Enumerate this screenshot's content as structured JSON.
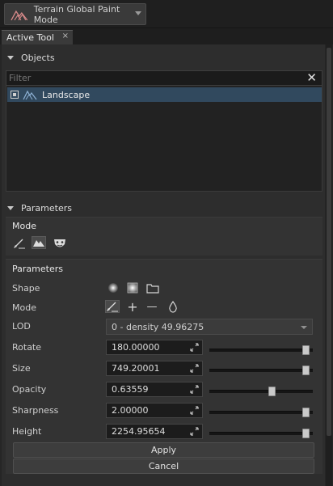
{
  "toolbar": {
    "mode_label": "Terrain Global Paint Mode",
    "mode_icon": "terrain-mountains-icon"
  },
  "tabs": [
    {
      "label": "Active Tool",
      "close": "×"
    }
  ],
  "objects": {
    "header": "Objects",
    "filter_placeholder": "Filter",
    "clear_glyph": "✕",
    "items": [
      {
        "label": "Landscape",
        "icon": "landscape-icon",
        "selected": true
      }
    ]
  },
  "parameters": {
    "header": "Parameters",
    "mode_section": {
      "title": "Mode",
      "tools": [
        "paint-brush-icon",
        "terrain-sculpt-icon",
        "mask-icon"
      ],
      "active_index": 1
    },
    "params_section": {
      "title": "Parameters",
      "shape": {
        "label": "Shape",
        "options": [
          "sphere-shape-icon",
          "square-shape-icon",
          "folder-icon"
        ]
      },
      "mode": {
        "label": "Mode",
        "options": [
          "brush-icon",
          "plus-icon",
          "minus-icon",
          "drop-icon"
        ],
        "plus": "+",
        "minus": "—"
      },
      "lod": {
        "label": "LOD",
        "value": "0 - density 49.96275"
      },
      "rotate": {
        "label": "Rotate",
        "value": "180.00000",
        "slider": 1.0
      },
      "size": {
        "label": "Size",
        "value": "749.20001",
        "slider": 1.0
      },
      "opacity": {
        "label": "Opacity",
        "value": "0.63559",
        "slider": 0.63559
      },
      "sharpness": {
        "label": "Sharpness",
        "value": "2.00000",
        "slider": 1.0
      },
      "height": {
        "label": "Height",
        "value": "2254.95654",
        "slider": 1.0
      }
    },
    "apply_label": "Apply",
    "cancel_label": "Cancel"
  }
}
